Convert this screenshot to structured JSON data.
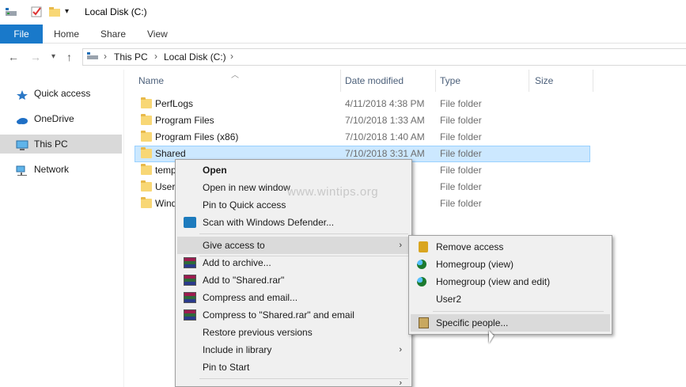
{
  "window": {
    "title": "Local Disk (C:)"
  },
  "ribbon": {
    "tabs": [
      "File",
      "Home",
      "Share",
      "View"
    ]
  },
  "address": {
    "crumbs": [
      "This PC",
      "Local Disk (C:)"
    ]
  },
  "nav_pane": {
    "items": [
      {
        "label": "Quick access",
        "icon": "star-icon"
      },
      {
        "label": "OneDrive",
        "icon": "cloud-icon"
      },
      {
        "label": "This PC",
        "icon": "computer-icon",
        "selected": true
      },
      {
        "label": "Network",
        "icon": "network-icon"
      }
    ]
  },
  "columns": [
    "Name",
    "Date modified",
    "Type",
    "Size"
  ],
  "files": [
    {
      "name": "PerfLogs",
      "date": "4/11/2018 4:38 PM",
      "type": "File folder"
    },
    {
      "name": "Program Files",
      "date": "7/10/2018 1:33 AM",
      "type": "File folder"
    },
    {
      "name": "Program Files (x86)",
      "date": "7/10/2018 1:40 AM",
      "type": "File folder"
    },
    {
      "name": "Shared",
      "date": "7/10/2018 3:31 AM",
      "type": "File folder",
      "selected": true
    },
    {
      "name": "temp",
      "date": "",
      "type": "File folder"
    },
    {
      "name": "User",
      "date": "",
      "type": "File folder"
    },
    {
      "name": "Wind",
      "date": "",
      "type": "File folder"
    }
  ],
  "context_menu": {
    "items": [
      "Open",
      "Open in new window",
      "Pin to Quick access",
      "Scan with Windows Defender...",
      "Give access to",
      "Add to archive...",
      "Add to \"Shared.rar\"",
      "Compress and email...",
      "Compress to \"Shared.rar\" and email",
      "Restore previous versions",
      "Include in library",
      "Pin to Start"
    ]
  },
  "submenu": {
    "items": [
      "Remove access",
      "Homegroup (view)",
      "Homegroup (view and edit)",
      "User2",
      "Specific people..."
    ]
  },
  "watermark": "www.wintips.org",
  "colors": {
    "accent": "#1979ca",
    "selection": "#cce8ff",
    "menu_bg": "#f0f0f0"
  }
}
